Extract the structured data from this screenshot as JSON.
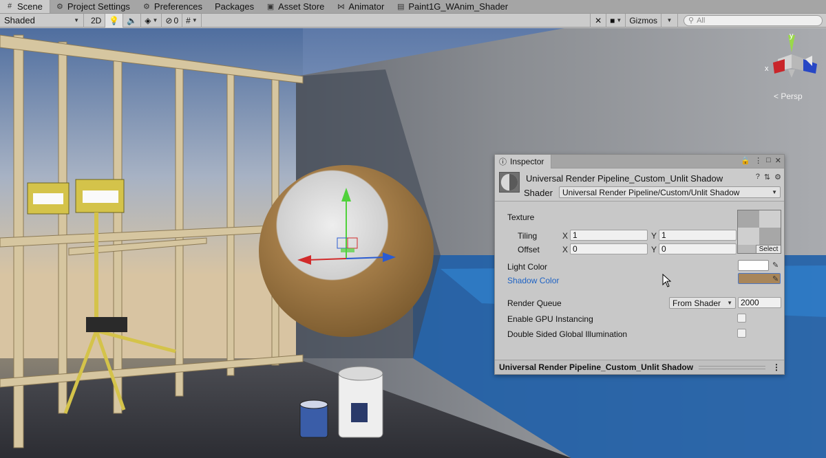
{
  "tabs": [
    {
      "label": "Scene",
      "icon": "grid-icon",
      "active": true
    },
    {
      "label": "Project Settings",
      "icon": "gear-icon"
    },
    {
      "label": "Preferences",
      "icon": "gear-icon"
    },
    {
      "label": "Packages",
      "icon": ""
    },
    {
      "label": "Asset Store",
      "icon": "store-icon"
    },
    {
      "label": "Animator",
      "icon": "animator-icon"
    },
    {
      "label": "Paint1G_WAnim_Shader",
      "icon": "shader-graph-icon"
    }
  ],
  "toolbar": {
    "draw_mode": "Shaded",
    "mode_2d": "2D",
    "hidden_count": "0",
    "gizmos": "Gizmos",
    "search_placeholder": "All"
  },
  "scene": {
    "axis_x": "x",
    "axis_y": "y",
    "projection": "Persp"
  },
  "inspector": {
    "tab_label": "Inspector",
    "material_name": "Universal Render Pipeline_Custom_Unlit Shadow",
    "shader_label": "Shader",
    "shader_value": "Universal Render Pipeline/Custom/Unlit Shadow",
    "texture_label": "Texture",
    "tiling_label": "Tiling",
    "offset_label": "Offset",
    "x_label": "X",
    "y_label": "Y",
    "tiling_x": "1",
    "tiling_y": "1",
    "offset_x": "0",
    "offset_y": "0",
    "select_label": "Select",
    "light_color_label": "Light Color",
    "light_color": "#ffffff",
    "shadow_color_label": "Shadow Color",
    "shadow_color": "#a8865a",
    "render_queue_label": "Render Queue",
    "render_queue_mode": "From Shader",
    "render_queue_value": "2000",
    "gpu_instancing_label": "Enable GPU Instancing",
    "double_sided_gi_label": "Double Sided Global Illumination",
    "footer_title": "Universal Render Pipeline_Custom_Unlit Shadow"
  }
}
